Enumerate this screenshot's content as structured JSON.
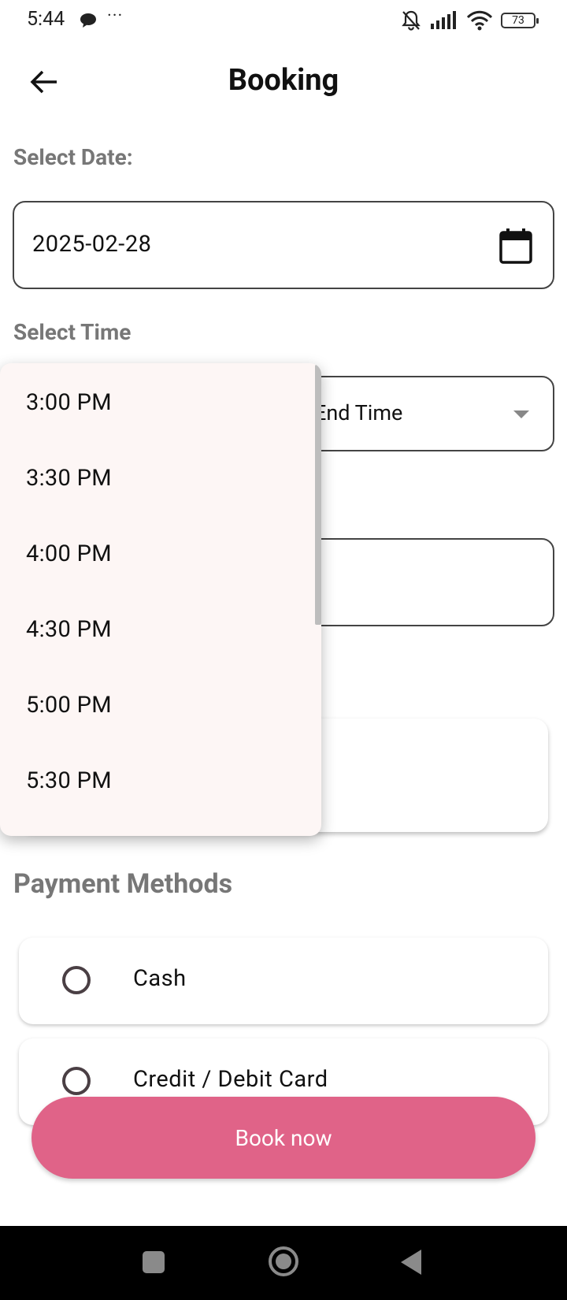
{
  "status_bar": {
    "time": "5:44",
    "dots": "···",
    "battery": "73"
  },
  "header": {
    "title": "Booking"
  },
  "date_section": {
    "label": "Select Date:",
    "value": "2025-02-28"
  },
  "time_section": {
    "label": "Select Time",
    "end_time_placeholder": "End Time"
  },
  "time_menu": {
    "options": [
      "3:00 PM",
      "3:30 PM",
      "4:00 PM",
      "4:30 PM",
      "5:00 PM",
      "5:30 PM"
    ]
  },
  "payment": {
    "title": "Payment Methods",
    "methods": [
      {
        "label": "Cash",
        "selected": false
      },
      {
        "label": "Credit / Debit Card",
        "selected": false
      }
    ]
  },
  "book_button": {
    "label": "Book now"
  },
  "colors": {
    "accent": "#e06388",
    "menu_bg": "#fdf6f5",
    "label_gray": "#777777"
  },
  "icons": [
    "back-arrow-icon",
    "calendar-icon",
    "chevron-down-icon",
    "chat-icon",
    "bell-off-icon",
    "signal-icon",
    "wifi-icon",
    "battery-icon"
  ]
}
